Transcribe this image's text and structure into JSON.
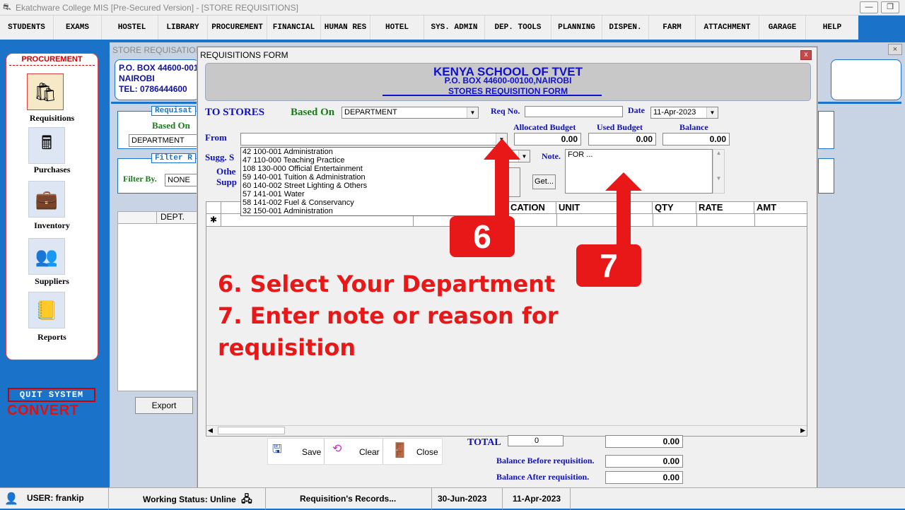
{
  "window": {
    "title": "Ekatchware College MIS [Pre-Secured Version] - [STORE REQUISITIONS]",
    "minimize": "▭",
    "restore": "❐"
  },
  "menu": [
    "STUDENTS",
    "EXAMS",
    "HOSTEL",
    "LIBRARY",
    "PROCUREMENT",
    "FINANCIAL",
    "HUMAN RES",
    "HOTEL",
    "SYS. ADMIN",
    "DEP. TOOLS",
    "PLANNING",
    "DISPEN.",
    "FARM",
    "ATTACHMENT",
    "GARAGE",
    "HELP"
  ],
  "sidebar": {
    "heading": "PROCUREMENT",
    "items": [
      {
        "label": "Requisitions",
        "icon": "shopping-bag-icon"
      },
      {
        "label": "Purchases",
        "icon": "cash-register-icon"
      },
      {
        "label": "Inventory",
        "icon": "briefcase-icon"
      },
      {
        "label": "Suppliers",
        "icon": "people-icon"
      },
      {
        "label": "Reports",
        "icon": "accounts-report-icon"
      }
    ],
    "quit": "QUIT SYSTEM",
    "convert": "CONVERT"
  },
  "background_window": {
    "title": "STORE REQUISATIONS",
    "address_line1": "P.O. BOX 44600-001",
    "address_line2": "NAIROBI",
    "address_line3": "TEL: 0786444600",
    "requisition_legend": "Requisat",
    "based_on_label": "Based On",
    "based_on_value": "DEPARTMENT",
    "filter_legend": "Filter R",
    "filter_by_label": "Filter By.",
    "filter_by_value": "NONE",
    "grid_col": "DEPT.",
    "export_button": "Export"
  },
  "form": {
    "title": "REQUISITIONS FORM",
    "close": "x",
    "header": {
      "school": "KENYA SCHOOL OF TVET",
      "address": "P.O. BOX 44600-00100,NAIROBI",
      "form_name": "STORES REQUISITION FORM"
    },
    "to_stores": "TO STORES",
    "based_on_label": "Based On",
    "based_on_value": "DEPARTMENT",
    "req_no_label": "Req No.",
    "req_no_value": "",
    "date_label": "Date",
    "date_value": "11-Apr-2023",
    "from_label": "From",
    "from_value": "",
    "allocated_budget_label": "Allocated Budget",
    "allocated_budget_value": "0.00",
    "used_budget_label": "Used Budget",
    "used_budget_value": "0.00",
    "balance_label": "Balance",
    "balance_value": "0.00",
    "sugg_label": "Sugg. S",
    "other_label": "Othe",
    "supp_label": "Supp",
    "get_button": "Get...",
    "note_label": "Note.",
    "note_value": "FOR ...",
    "dropdown_options": [
      "42 100-001 Administration",
      "47 110-000 Teaching Practice",
      "108 130-000 Official Entertainment",
      "59 140-001 Tuition & Administration",
      "60 140-002 Street Lighting & Others",
      "57 141-001 Water",
      "58 141-002 Fuel & Conservancy",
      "32 150-001 Administration"
    ],
    "grid_columns": [
      "",
      "",
      "",
      "CATION",
      "UNIT",
      "QTY",
      "RATE",
      "AMT"
    ],
    "new_row_marker": "✱",
    "toolbar": {
      "save": "Save",
      "clear": "Clear",
      "close": "Close"
    },
    "total_label": "TOTAL",
    "total_qty": "0",
    "total_value": "0.00",
    "balance_before_label": "Balance Before requisition.",
    "balance_before_value": "0.00",
    "balance_after_label": "Balance After requisition.",
    "balance_after_value": "0.00"
  },
  "annotations": {
    "callout6": "6",
    "callout7": "7",
    "line1": "6. Select Your Department",
    "line2": "7. Enter note or reason for",
    "line3": "requisition",
    "color": "#e81818"
  },
  "statusbar": {
    "user": "USER: frankip",
    "working_status": "Working Status: Unline",
    "records": "Requisition's Records...",
    "date1": "30-Jun-2023",
    "date2": "11-Apr-2023"
  }
}
